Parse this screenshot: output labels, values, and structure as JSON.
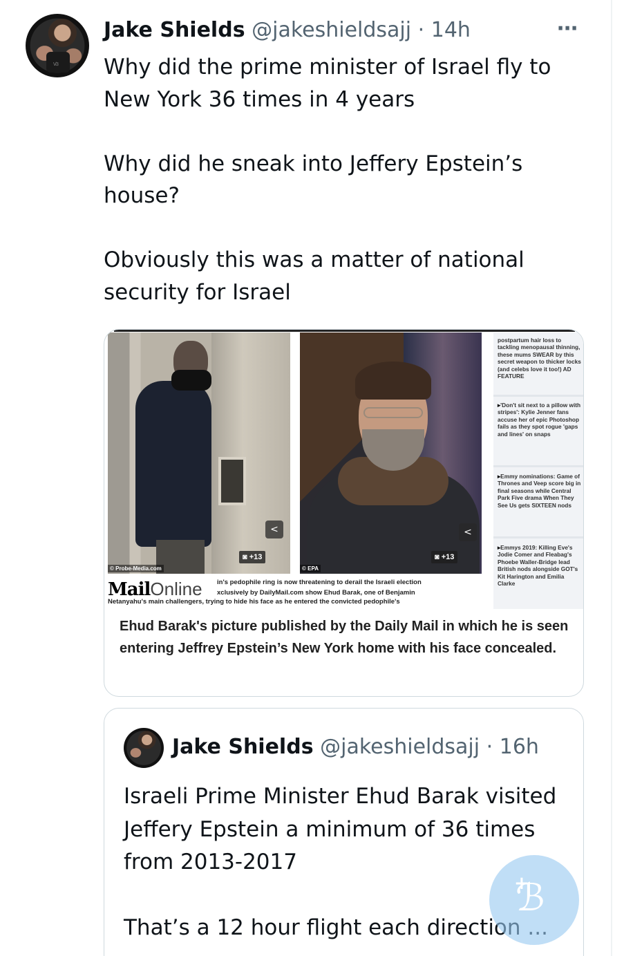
{
  "tweet": {
    "author_name": "Jake Shields",
    "author_handle": "@jakeshieldsajj",
    "separator": "·",
    "time": "14h",
    "more_icon": "more-horizontal-icon",
    "text": "Why did the prime minister of Israel fly to\nNew York 36 times in 4 years\n\nWhy did he sneak into Jeffery Epstein’s\nhouse?\n\nObviously this was a matter of national\nsecurity for Israel"
  },
  "media": {
    "photo_left_credit": "© Probe-Media.com",
    "photo_right_credit": "© EPA",
    "photo_left_count": "+13",
    "photo_right_count": "+13",
    "sidebar_items": [
      "postpartum hair loss to tackling menopausal thinning, these mums SWEAR by this secret weapon to thicker locks (and celebs love it too!) AD FEATURE",
      "'Don't sit next to a pillow with stripes': Kylie Jenner fans accuse her of epic Photoshop fails as they spot rogue 'gaps and lines' on snaps",
      "Emmy nominations: Game of Thrones and Veep score big in final seasons while Central Park Five drama When They See Us gets SIXTEEN nods",
      "Emmys 2019: Killing Eve's Jodie Comer and Fleabag's Phoebe Waller-Bridge lead British nods alongside GOT's Kit Harington and Emilia Clarke"
    ],
    "logo_mail": "Mail",
    "logo_online": "Online",
    "caption_line1": "in's pedophile ring is now threatening to derail the Israeli election",
    "caption_line2": "xclusively by DailyMail.com show Ehud Barak, one of Benjamin",
    "caption_line3": "Netanyahu's main challengers, trying to hide his face as he entered the convicted pedophile's",
    "card_caption": "Ehud Barak's picture published by the Daily Mail in which he is seen entering Jeffrey Epstein’s New York home with his face concealed."
  },
  "quoted": {
    "author_name": "Jake Shields",
    "author_handle": "@jakeshieldsajj",
    "separator": "·",
    "time": "16h",
    "text": "Israeli Prime Minister Ehud Barak visited\nJeffery Epstein a minimum of 36 times\nfrom 2013-2017\n\nThat’s a 12 hour flight each direction ..."
  },
  "compose_fab": {
    "icon": "compose-feather-icon",
    "color": "#1d9bf0"
  }
}
